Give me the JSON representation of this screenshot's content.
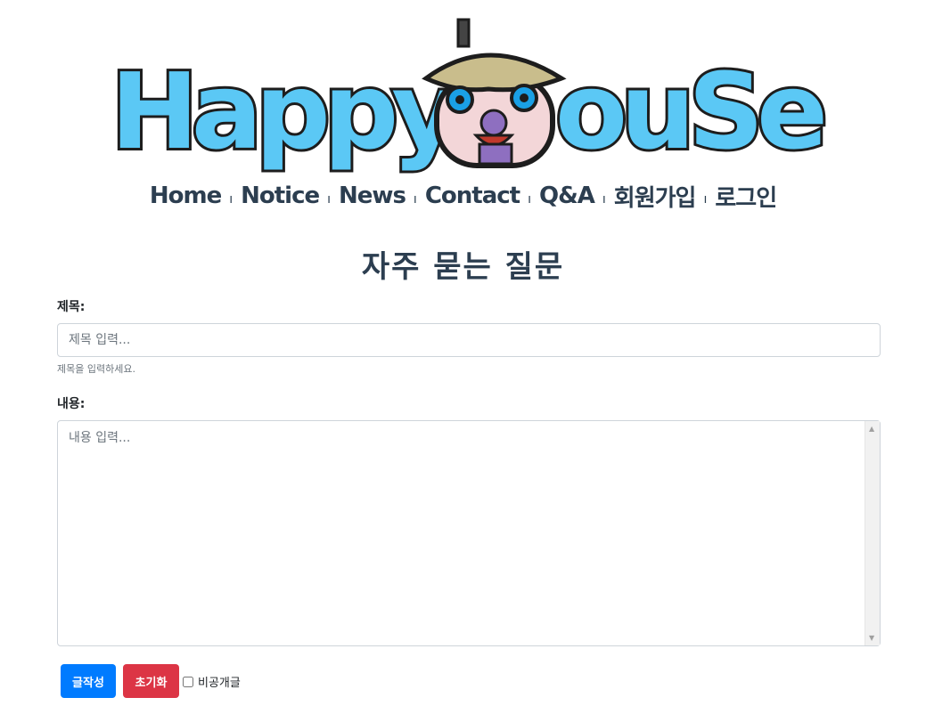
{
  "brand": {
    "logo_text": "HappyHouse"
  },
  "nav": {
    "items": [
      "Home",
      "Notice",
      "News",
      "Contact",
      "Q&A",
      "회원가입",
      "로그인"
    ],
    "separator": "ı"
  },
  "page": {
    "title": "자주 묻는 질문"
  },
  "form": {
    "title_label": "제목:",
    "title_placeholder": "제목 입력...",
    "title_help": "제목을 입력하세요.",
    "content_label": "내용:",
    "content_placeholder": "내용 입력...",
    "submit_label": "글작성",
    "reset_label": "초기화",
    "secret_label": "비공개글"
  },
  "colors": {
    "primary": "#007bff",
    "danger": "#dc3545",
    "heading": "#2c3e50",
    "logo_fill": "#5bc8f5"
  }
}
